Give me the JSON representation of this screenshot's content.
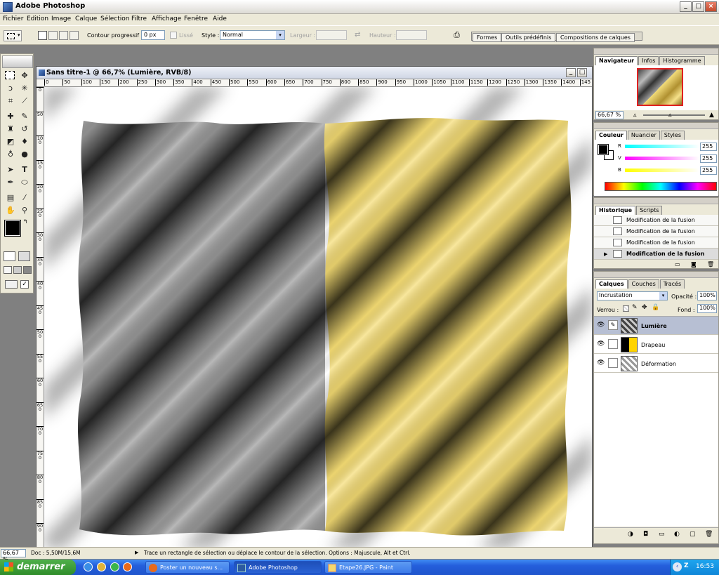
{
  "window": {
    "title": "Adobe Photoshop",
    "controls": {
      "minimize": "_",
      "maximize": "□",
      "close": "×"
    }
  },
  "menu": [
    "Fichier",
    "Edition",
    "Image",
    "Calque",
    "Sélection",
    "Filtre",
    "Affichage",
    "Fenêtre",
    "Aide"
  ],
  "options": {
    "feather_label": "Contour progressif :",
    "feather_value": "0 px",
    "antialias_label": "Lissé",
    "style_label": "Style :",
    "style_value": "Normal",
    "width_label": "Largeur :",
    "height_label": "Hauteur :",
    "tabs": [
      "Formes",
      "Outils prédéfinis",
      "Compositions de calques"
    ]
  },
  "document": {
    "title": "Sans titre-1 @ 66,7% (Lumière, RVB/8)",
    "ruler_top": [
      "0",
      "50",
      "100",
      "150",
      "200",
      "250",
      "300",
      "350",
      "400",
      "450",
      "500",
      "550",
      "600",
      "650",
      "700",
      "750",
      "800",
      "850",
      "900",
      "950",
      "1000",
      "1050",
      "1100",
      "1150",
      "1200",
      "1250",
      "1300",
      "1350",
      "1400",
      "145"
    ],
    "ruler_left": [
      "0",
      "50",
      "100",
      "150",
      "200",
      "250",
      "300",
      "350",
      "400",
      "450",
      "500",
      "550",
      "600",
      "650",
      "700",
      "750",
      "800",
      "850",
      "900",
      "950"
    ]
  },
  "navigator": {
    "tabs": [
      "Navigateur",
      "Infos",
      "Histogramme"
    ],
    "zoom": "66,67 %"
  },
  "color": {
    "tabs": [
      "Couleur",
      "Nuancier",
      "Styles"
    ],
    "channels": [
      {
        "label": "R",
        "value": "255",
        "color": "#ff0000"
      },
      {
        "label": "V",
        "value": "255",
        "color": "#00c000"
      },
      {
        "label": "B",
        "value": "255",
        "color": "#0000ff"
      }
    ]
  },
  "history": {
    "tabs": [
      "Historique",
      "Scripts"
    ],
    "items": [
      "Modification de la fusion",
      "Modification de la fusion",
      "Modification de la fusion",
      "Modification de la fusion"
    ]
  },
  "layers": {
    "tabs": [
      "Calques",
      "Couches",
      "Tracés"
    ],
    "blend_mode": "Incrustation",
    "opacity_label": "Opacité :",
    "opacity_value": "100%",
    "lock_label": "Verrou :",
    "fill_label": "Fond :",
    "fill_value": "100%",
    "items": [
      {
        "name": "Lumière",
        "selected": true
      },
      {
        "name": "Drapeau",
        "selected": false
      },
      {
        "name": "Déformation",
        "selected": false
      }
    ]
  },
  "status": {
    "zoom": "66,67 %",
    "doc": "Doc : 5,50M/15,6M",
    "hint": "Trace un rectangle de sélection ou déplace le contour de la sélection. Options : Majuscule, Alt et Ctrl."
  },
  "taskbar": {
    "start": "demarrer",
    "items": [
      "Poster un nouveau s...",
      "Adobe Photoshop",
      "Etape26.JPG - Paint"
    ],
    "clock": "16:53",
    "tray_text": "Z"
  }
}
